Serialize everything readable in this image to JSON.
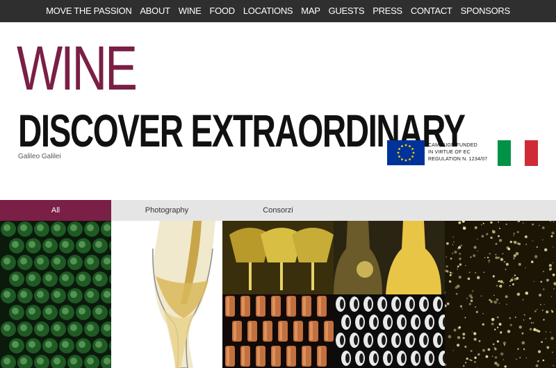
{
  "nav": {
    "items": [
      "MOVE THE PASSION",
      "ABOUT",
      "WINE",
      "FOOD",
      "LOCATIONS",
      "MAP",
      "GUESTS",
      "PRESS",
      "CONTACT",
      "SPONSORS"
    ]
  },
  "hero": {
    "title": "WINE",
    "subtitle": "DISCOVER EXTRAORDINARY",
    "credit": "Galileo Galilei"
  },
  "campaign": {
    "line1": "CAMPAIGN FUNDED",
    "line2": "IN VIRTUE OF EC",
    "line3": "REGULATION N. 1234/07"
  },
  "tabs": [
    {
      "label": "All",
      "active": true
    },
    {
      "label": "Photography",
      "active": false
    },
    {
      "label": "Consorzi",
      "active": false
    }
  ],
  "colors": {
    "accent": "#7a1f45",
    "nav_bg": "#2f2f2f",
    "tab_bg": "#e5e5e5",
    "eu_blue": "#003399",
    "eu_star": "#ffcc00",
    "it_green": "#009246",
    "it_white": "#ffffff",
    "it_red": "#ce2b37"
  }
}
